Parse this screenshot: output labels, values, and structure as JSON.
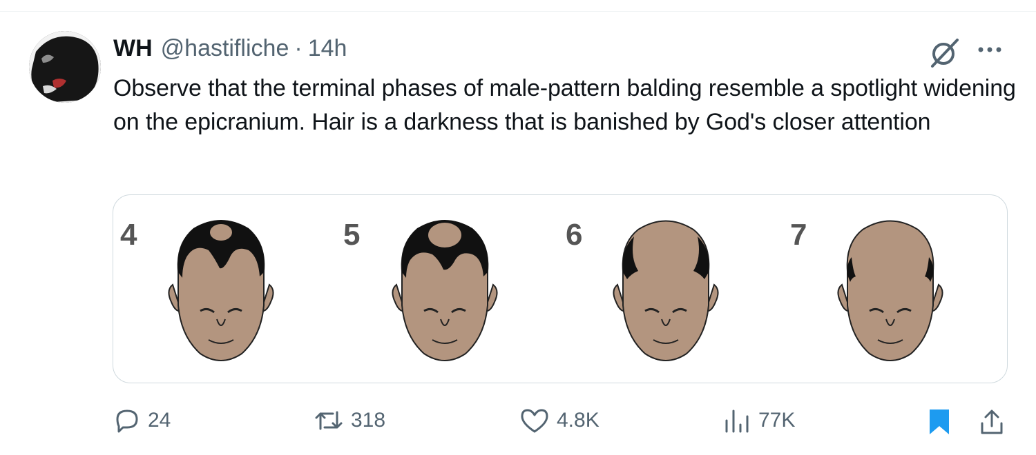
{
  "tweet": {
    "author_name": "WH",
    "handle": "@hastifliche",
    "separator": "·",
    "time": "14h",
    "text": "Observe that the terminal phases of male-pattern balding resemble a spotlight widening on the epicranium. Hair is a darkness that is banished by God's closer attention"
  },
  "media": {
    "stages": [
      {
        "label": "4"
      },
      {
        "label": "5"
      },
      {
        "label": "6"
      },
      {
        "label": "7"
      }
    ]
  },
  "actions": {
    "replies": "24",
    "reposts": "318",
    "likes": "4.8K",
    "views": "77K"
  },
  "colors": {
    "text": "#0f1419",
    "secondary": "#536471",
    "accent": "#1d9bf0",
    "skin": "#b3957f",
    "hair": "#111111",
    "border": "#cfd9de"
  },
  "icons": [
    "grok-icon",
    "more-icon",
    "reply-icon",
    "repost-icon",
    "like-icon",
    "views-icon",
    "bookmark-icon",
    "share-icon"
  ]
}
